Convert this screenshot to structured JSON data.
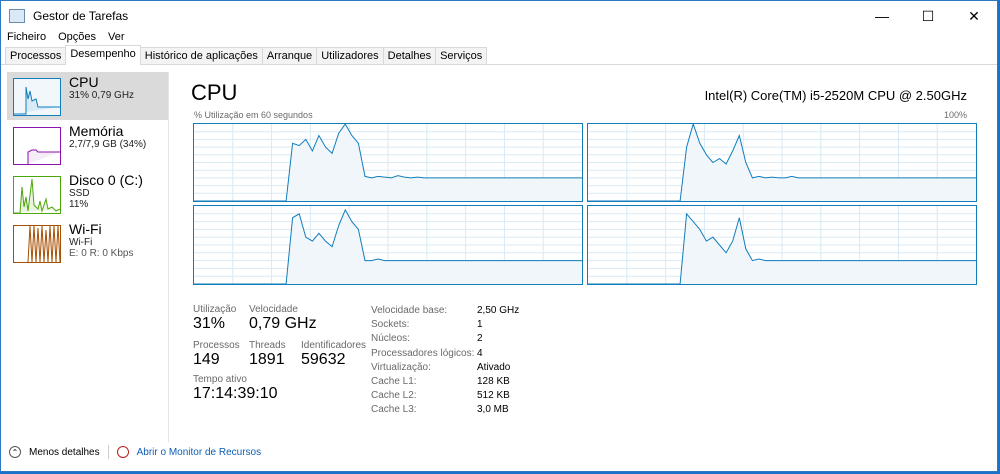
{
  "window": {
    "title": "Gestor de Tarefas",
    "minimize": "—",
    "maximize": "☐",
    "close": "✕"
  },
  "menu": [
    "Ficheiro",
    "Opções",
    "Ver"
  ],
  "tabs": [
    "Processos",
    "Desempenho",
    "Histórico de aplicações",
    "Arranque",
    "Utilizadores",
    "Detalhes",
    "Serviços"
  ],
  "sidebar": [
    {
      "name": "CPU",
      "l1": "31% 0,79 GHz",
      "l2": "",
      "color": "#117dbb"
    },
    {
      "name": "Memória",
      "l1": "2,7/7,9 GB (34%)",
      "l2": "",
      "color": "#8b12ae"
    },
    {
      "name": "Disco 0 (C:)",
      "l1": "SSD",
      "l2": "11%",
      "color": "#4da60c"
    },
    {
      "name": "Wi-Fi",
      "l1": "Wi-Fi",
      "l2": "E: 0 R: 0 Kbps",
      "color": "#a74f01"
    }
  ],
  "main": {
    "title": "CPU",
    "cpu_name": "Intel(R) Core(TM) i5-2520M CPU @ 2.50GHz",
    "caption": "% Utilização em 60 segundos",
    "max": "100%"
  },
  "stats": {
    "util_label": "Utilização",
    "util": "31%",
    "speed_label": "Velocidade",
    "speed": "0,79 GHz",
    "proc_label": "Processos",
    "proc": "149",
    "threads_label": "Threads",
    "threads": "1891",
    "handles_label": "Identificadores",
    "handles": "59632",
    "uptime_label": "Tempo ativo",
    "uptime": "17:14:39:10"
  },
  "specs": [
    [
      "Velocidade base:",
      "2,50 GHz"
    ],
    [
      "Sockets:",
      "1"
    ],
    [
      "Núcleos:",
      "2"
    ],
    [
      "Processadores lógicos:",
      "4"
    ],
    [
      "Virtualização:",
      "Ativado"
    ],
    [
      "Cache L1:",
      "128 KB"
    ],
    [
      "Cache L2:",
      "512 KB"
    ],
    [
      "Cache L3:",
      "3,0 MB"
    ]
  ],
  "footer": {
    "less": "Menos detalhes",
    "monitor": "Abrir o Monitor de Recursos"
  },
  "chart_data": {
    "type": "area",
    "title": "% Utilização em 60 segundos",
    "ylim": [
      0,
      100
    ],
    "x_seconds": 60,
    "series": [
      {
        "name": "core0",
        "values": [
          0,
          0,
          0,
          0,
          0,
          0,
          0,
          0,
          0,
          0,
          0,
          0,
          0,
          0,
          0,
          75,
          72,
          80,
          65,
          85,
          70,
          62,
          88,
          100,
          85,
          75,
          32,
          30,
          32,
          31,
          30,
          33,
          31,
          30,
          31,
          30,
          30,
          30,
          30,
          30,
          30,
          30,
          30,
          30,
          30,
          30,
          30,
          30,
          30,
          30,
          30,
          30,
          30,
          30,
          30,
          30,
          30,
          30,
          30,
          30
        ]
      },
      {
        "name": "core1",
        "values": [
          0,
          0,
          0,
          0,
          0,
          0,
          0,
          0,
          0,
          0,
          0,
          0,
          0,
          0,
          0,
          70,
          100,
          75,
          60,
          50,
          55,
          48,
          65,
          85,
          50,
          30,
          32,
          30,
          31,
          30,
          30,
          32,
          30,
          30,
          30,
          30,
          30,
          30,
          30,
          30,
          30,
          30,
          30,
          30,
          30,
          30,
          30,
          30,
          30,
          30,
          30,
          30,
          30,
          30,
          30,
          30,
          30,
          30,
          30,
          30
        ]
      },
      {
        "name": "core2",
        "values": [
          0,
          0,
          0,
          0,
          0,
          0,
          0,
          0,
          0,
          0,
          0,
          0,
          0,
          0,
          0,
          85,
          90,
          60,
          55,
          65,
          55,
          48,
          75,
          95,
          80,
          70,
          30,
          30,
          32,
          30,
          30,
          30,
          30,
          30,
          30,
          30,
          30,
          30,
          30,
          30,
          30,
          30,
          30,
          30,
          30,
          30,
          30,
          30,
          30,
          30,
          30,
          30,
          30,
          30,
          30,
          30,
          30,
          30,
          30,
          30
        ]
      },
      {
        "name": "core3",
        "values": [
          0,
          0,
          0,
          0,
          0,
          0,
          0,
          0,
          0,
          0,
          0,
          0,
          0,
          0,
          0,
          90,
          80,
          70,
          55,
          60,
          50,
          40,
          55,
          85,
          45,
          30,
          32,
          30,
          30,
          30,
          30,
          30,
          30,
          30,
          30,
          30,
          30,
          30,
          30,
          30,
          30,
          30,
          30,
          30,
          30,
          30,
          30,
          30,
          30,
          30,
          30,
          30,
          30,
          30,
          30,
          30,
          30,
          30,
          30,
          30
        ]
      }
    ]
  }
}
